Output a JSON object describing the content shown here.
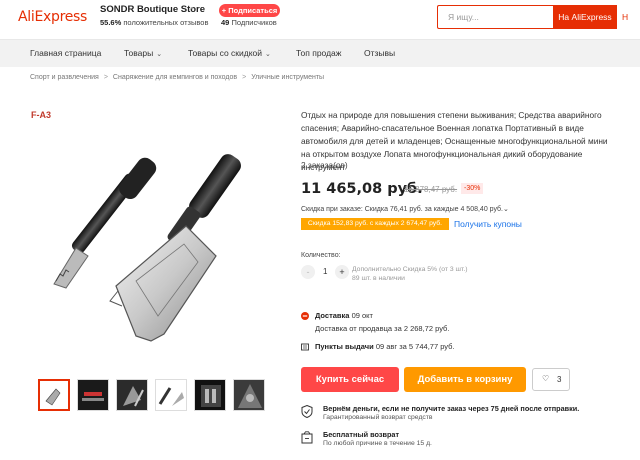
{
  "header": {
    "logo": "AliExpress",
    "store_name": "SONDR Boutique Store",
    "store_dot": "•",
    "rating_value": "55.6%",
    "rating_label": "положительных отзывов",
    "subscribe_label": "+ Подписаться",
    "subscribers_count": "49",
    "subscribers_label": "Подписчиков",
    "search_placeholder": "Я ищу...",
    "search_button": "На AliExpress",
    "search_extra": "Н"
  },
  "nav": {
    "items": [
      {
        "label": "Главная страница",
        "chevron": ""
      },
      {
        "label": "Товары",
        "chevron": "⌄"
      },
      {
        "label": "Товары со скидкой",
        "chevron": "⌄"
      },
      {
        "label": "Топ продаж",
        "chevron": ""
      },
      {
        "label": "Отзывы",
        "chevron": ""
      }
    ]
  },
  "breadcrumb": {
    "items": [
      "Спорт и развлечения",
      "Снаряжение для кемпингов и походов",
      "Уличные инструменты"
    ],
    "sep": ">"
  },
  "gallery": {
    "watermark": "F-A3",
    "thumb_count": 6
  },
  "product": {
    "title": "Отдых на природе для повышения степени выживания; Средства аварийного спасения; Аварийно-спасательное Военная лопатка Портативный в виде автомобиля для детей и младенцев; Оснащенные многофункциональной мини на открытом воздухе Лопата многофункциональная дикий оборудование инструмент",
    "orders": "2 заказа(ов)",
    "price": "11 465,08 руб.",
    "old_price": "16 378,47 руб.",
    "discount": "-30%",
    "order_discount": "Скидка при заказе: Скидка 76,41 руб. за каждые 4 508,40 руб.⌄",
    "coupon_tag": "Скидка 152,83 руб. с каждых 2 674,47 руб.",
    "coupon_link": "Получить купоны"
  },
  "quantity": {
    "label": "Количество:",
    "minus": "-",
    "value": "1",
    "plus": "+",
    "note_line1": "Дополнительно Скидка 5% (от 3 шт.)",
    "note_line2": "89 шт. в наличии"
  },
  "shipping": {
    "delivery_label": "Доставка",
    "delivery_date": "09 окт",
    "delivery_from": "Доставка от продавца за 2 268,72 руб.",
    "pickup_label": "Пункты выдачи",
    "pickup_text": "09 авг за 5 744,77 руб."
  },
  "actions": {
    "buy_now": "Купить сейчас",
    "add_to_cart": "Добавить в корзину",
    "wish_heart": "♡",
    "wish_count": "3"
  },
  "guarantees": [
    {
      "title": "Вернём деньги, если не получите заказ через 75 дней после отправки.",
      "subtitle": "Гарантированный возврат средств"
    },
    {
      "title": "Бесплатный возврат",
      "subtitle": "По любой причине в течение 15 д."
    }
  ],
  "colors": {
    "brand": "#e62e04",
    "buy": "#ff4747",
    "cart": "#ff9900",
    "coupon": "#ffa600",
    "link": "#1a73e8"
  }
}
